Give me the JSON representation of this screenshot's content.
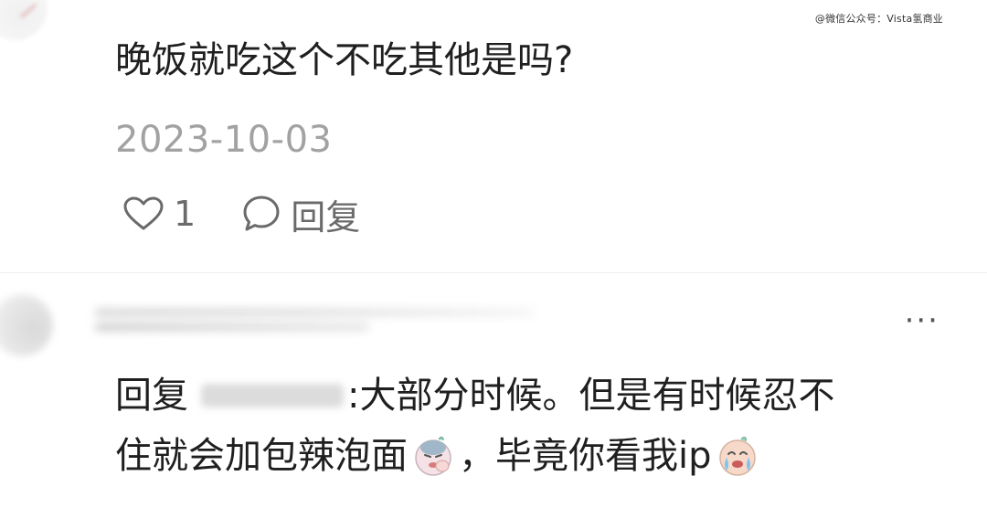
{
  "watermark": "@微信公众号：Vista氢商业",
  "comment": {
    "text": "晚饭就吃这个不吃其他是吗?",
    "date": "2023-10-03",
    "like_count": "1",
    "reply_label": "回复",
    "icons": {
      "like": "heart-icon",
      "reply": "speech-bubble-icon"
    }
  },
  "reply": {
    "more_label": "···",
    "prefix": "回复",
    "after_mention": ":大部分时候。但是有时候忍不",
    "line2_part1": "住就会加包辣泡面",
    "line2_part2": "，毕竟你看我ip",
    "emojis": [
      "facepalm-emoji",
      "crying-emoji"
    ]
  }
}
